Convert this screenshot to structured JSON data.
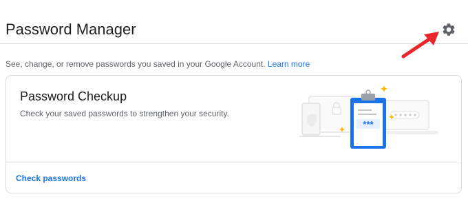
{
  "header": {
    "title": "Password Manager"
  },
  "description": {
    "text": "See, change, or remove passwords you saved in your Google Account.",
    "link": "Learn more"
  },
  "checkup": {
    "title": "Password Checkup",
    "subtitle": "Check your saved passwords to strengthen your security.",
    "action": "Check passwords",
    "clipboard_text": "***"
  },
  "colors": {
    "accent": "#1a73e8",
    "arrow": "#e8262c",
    "sparkle": "#fbbc04"
  },
  "icons": [
    "gear-icon",
    "red-arrow-icon",
    "clipboard-icon",
    "lock-icon",
    "shield-icon",
    "sparkle-icon"
  ]
}
